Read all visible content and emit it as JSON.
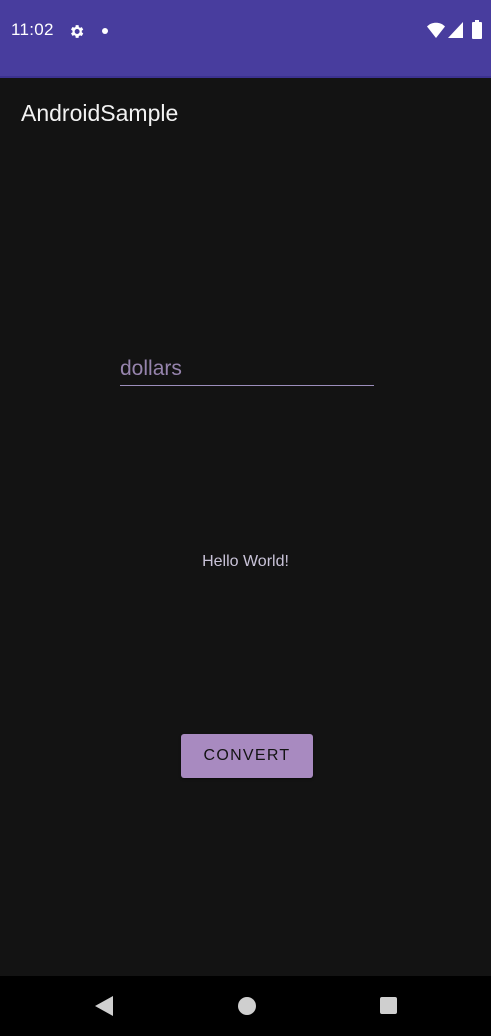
{
  "status_bar": {
    "time": "11:02",
    "icons": [
      "gear-icon",
      "notification-dot-icon",
      "wifi-icon",
      "cell-signal-icon",
      "battery-icon"
    ],
    "background_color": "#483d9e"
  },
  "app_bar": {
    "title": "AndroidSample"
  },
  "main": {
    "dollars_input": {
      "value": "",
      "placeholder": "dollars"
    },
    "result_text": "Hello World!",
    "convert_button_label": "CONVERT",
    "accent_color": "#a88ac0"
  },
  "nav_bar": {
    "icons": [
      "back-icon",
      "home-icon",
      "recents-icon"
    ]
  }
}
